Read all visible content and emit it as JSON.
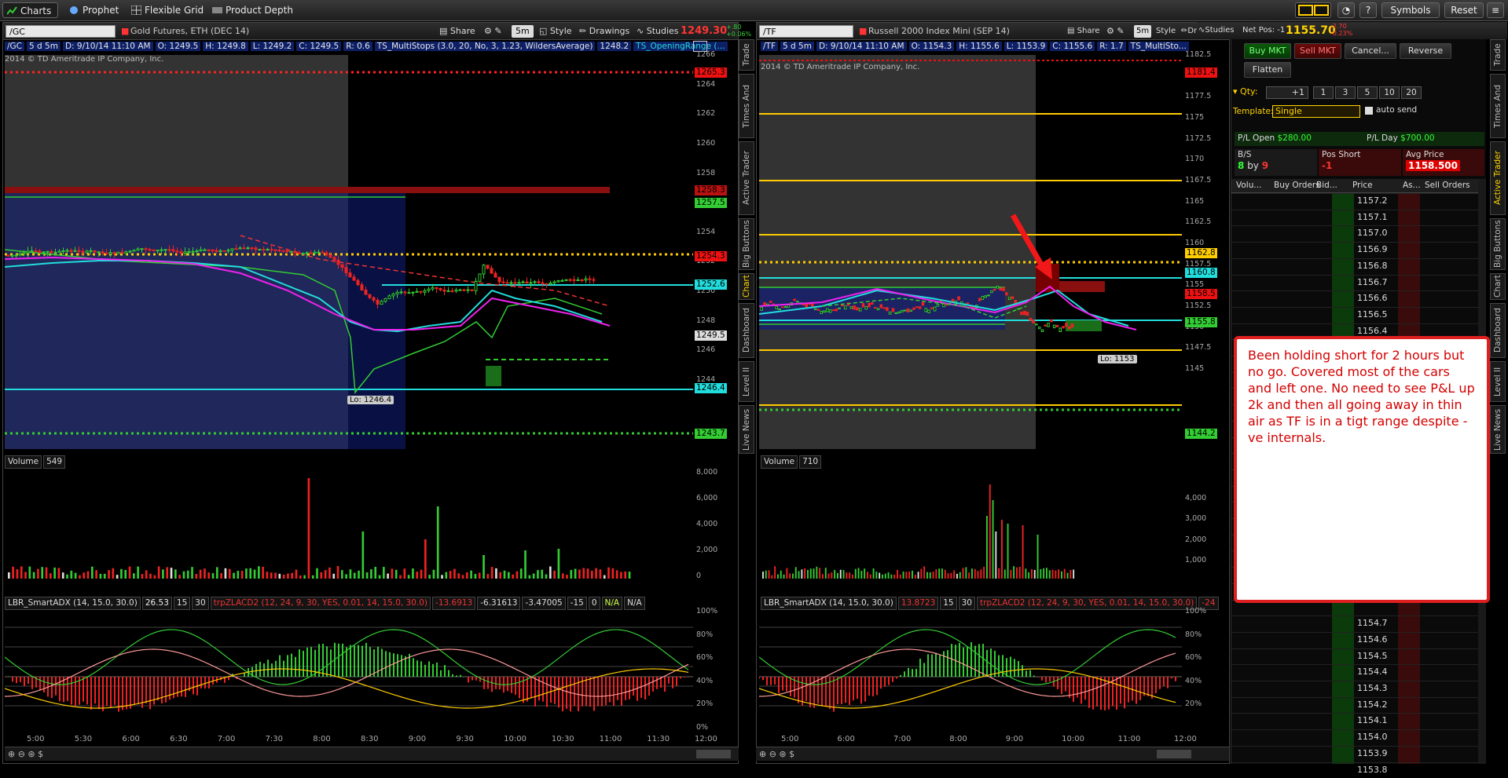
{
  "toolbar": {
    "tabs": [
      "Charts",
      "Prophet",
      "Flexible Grid",
      "Product Depth"
    ],
    "symbols_label": "Symbols",
    "reset_label": "Reset"
  },
  "left_chart": {
    "symbol": "/GC",
    "period": "5 d 5m",
    "name": "Gold Futures, ETH (DEC 14)",
    "last": "1249.30",
    "chg": "+.80",
    "chg_pct": "+0.06%",
    "share": "Share",
    "aggregation": "5m",
    "style": "Style",
    "drawings": "Drawings",
    "studies": "Studies",
    "info": {
      "date": "D: 9/10/14 11:10 AM",
      "o": "O: 1249.5",
      "h": "H: 1249.8",
      "l": "L: 1249.2",
      "c": "C: 1249.5",
      "r": "R: 0.6",
      "study": "TS_MultiStops (3.0, 20, No, 3, 1.23, WildersAverage)",
      "study_val": "1248.2",
      "study2": "TS_OpeningRange (..."
    },
    "copyright": "2014 © TD Ameritrade IP Company, Inc.",
    "price_ticks": [
      "1266",
      "1264",
      "1262",
      "1260",
      "1258",
      "1256",
      "1254",
      "1252",
      "1250",
      "1248",
      "1246",
      "1244"
    ],
    "tags": [
      "1265.3",
      "1258.3",
      "1257.5",
      "1254.3",
      "1252.6",
      "1249.5",
      "1246.4",
      "1243.7"
    ],
    "lo_label": "Lo: 1246.4",
    "volume": {
      "label": "Volume",
      "value": "549",
      "ticks": [
        "8,000",
        "6,000",
        "4,000",
        "2,000",
        "0"
      ]
    },
    "lower": {
      "s1": "LBR_SmartADX (14, 15.0, 30.0)",
      "v1": "26.53",
      "v2": "15",
      "v3": "30",
      "s2": "trpZLACD2 (12, 24, 9, 30, YES, 0.01, 14, 15.0, 30.0)",
      "v4": "-13.6913",
      "v5": "-6.31613",
      "v6": "-3.47005",
      "v7": "-15",
      "v8": "0",
      "v9": "N/A",
      "v10": "N/A",
      "ticks": [
        "100%",
        "80%",
        "60%",
        "40%",
        "20%",
        "0%"
      ]
    },
    "time_ticks": [
      "5:00",
      "5:30",
      "6:00",
      "6:30",
      "7:00",
      "7:30",
      "8:00",
      "8:30",
      "9:00",
      "9:30",
      "10:00",
      "10:30",
      "11:00",
      "11:30",
      "12:00"
    ]
  },
  "right_chart": {
    "symbol": "/TF",
    "period": "5 d 5m",
    "name": "Russell 2000 Index Mini (SEP 14)",
    "last": "1155.70",
    "chg": "-2.70",
    "chg_pct": "-0.23%",
    "net_pos": "Net Pos: -1",
    "share": "Share",
    "aggregation": "5m",
    "style": "Style",
    "drawings": "Drawings",
    "studies": "Studies",
    "info": {
      "date": "D: 9/10/14 11:10 AM",
      "o": "O: 1154.3",
      "h": "H: 1155.6",
      "l": "L: 1153.9",
      "c": "C: 1155.6",
      "r": "R: 1.7",
      "study": "TS_MultiSto..."
    },
    "copyright": "2014 © TD Ameritrade IP Company, Inc.",
    "price_ticks": [
      "1182.5",
      "1180",
      "1177.5",
      "1175",
      "1172.5",
      "1170",
      "1167.5",
      "1165",
      "1162.5",
      "1160",
      "1157.5",
      "1155",
      "1152.5",
      "1150",
      "1147.5",
      "1145"
    ],
    "tags": [
      "1181.4",
      "1162.8",
      "1160.8",
      "1158.5",
      "1155.8",
      "1144.2"
    ],
    "lo_label": "Lo: 1153",
    "volume": {
      "label": "Volume",
      "value": "710",
      "ticks": [
        "4,000",
        "3,000",
        "2,000",
        "1,000"
      ]
    },
    "lower": {
      "s1": "LBR_SmartADX (14, 15.0, 30.0)",
      "v1": "13.8723",
      "v2": "15",
      "v3": "30",
      "s2": "trpZLACD2 (12, 24, 9, 30, YES, 0.01, 14, 15.0, 30.0)",
      "v4": "-24",
      "ticks": [
        "100%",
        "80%",
        "60%",
        "40%",
        "20%"
      ]
    },
    "time_ticks": [
      "5:00",
      "6:00",
      "7:00",
      "8:00",
      "9:00",
      "10:00",
      "11:00",
      "12:00"
    ]
  },
  "active_trader": {
    "buy_mkt": "Buy MKT",
    "sell_mkt": "Sell MKT",
    "cancel": "Cancel...",
    "reverse": "Reverse",
    "flatten": "Flatten",
    "qty_label": "Qty:",
    "qty": "+1",
    "qty_btns": [
      "1",
      "3",
      "5",
      "10",
      "20"
    ],
    "template_label": "Template:",
    "template": "Single",
    "auto_send": "auto send",
    "pl_open_label": "P/L Open",
    "pl_open": "$280.00",
    "pl_day_label": "P/L Day",
    "pl_day": "$700.00",
    "bs_label": "B/S",
    "bs_buy": "8",
    "bs_by": "by",
    "bs_sell": "9",
    "pos_label": "Pos Short",
    "pos": "-1",
    "avg_label": "Avg Price",
    "avg": "1158.500",
    "columns": [
      "Volu...",
      "Buy Orders",
      "Bid...",
      "Price",
      "As...",
      "Sell Orders"
    ],
    "prices_top": [
      "1157.2",
      "1157.1",
      "1157.0",
      "1156.9",
      "1156.8",
      "1156.7",
      "1156.6",
      "1156.5",
      "1156.4"
    ],
    "prices_bottom": [
      "1154.7",
      "1154.6",
      "1154.5",
      "1154.4",
      "1154.3",
      "1154.2",
      "1154.1",
      "1154.0",
      "1153.9",
      "1153.8"
    ]
  },
  "side_tabs": [
    "Trade",
    "Times And Sales",
    "Active Trader",
    "Big Buttons",
    "Chart",
    "Dashboard",
    "Level II",
    "Live News"
  ],
  "note": "Been holding short for 2 hours but no go. Covered most of the cars and left one. No need to see P&L up 2k and then all going away in thin air as TF is in a tigt range despite -ve internals."
}
